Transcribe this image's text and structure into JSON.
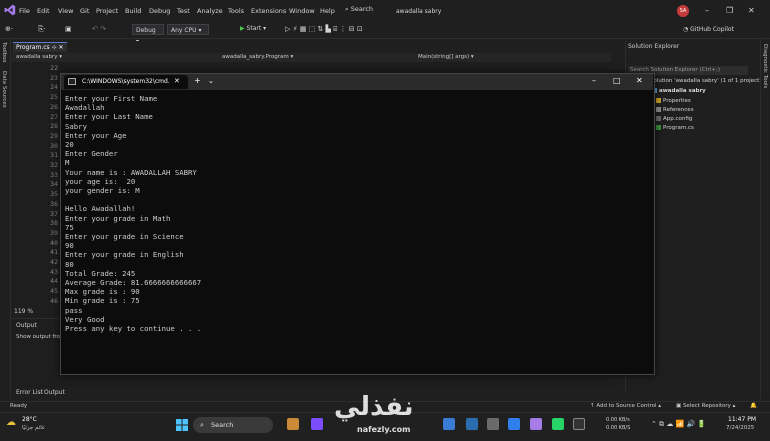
{
  "titlebar": {
    "menu": [
      "File",
      "Edit",
      "View",
      "Git",
      "Project",
      "Build",
      "Debug",
      "Test",
      "Analyze",
      "Tools",
      "Extensions",
      "Window",
      "Help"
    ],
    "search_label": "Search",
    "solution_name": "awadalla sabry",
    "avatar_initials": "SA",
    "minimize": "–",
    "restore": "❐",
    "close": "✕"
  },
  "toolbar": {
    "config": "Debug",
    "platform": "Any CPU",
    "start_label": "Start",
    "copilot_label": "GitHub Copilot"
  },
  "left_rail": {
    "toolbox": "Toolbox",
    "data_sources": "Data Sources"
  },
  "editor": {
    "file_tab": "Program.cs",
    "nav_project": "awadalla sabry",
    "nav_class": "awadalla_sabry.Program",
    "nav_member": "Main(string[] args)",
    "line_numbers": [
      "22",
      "23",
      "24",
      "25",
      "26",
      "27",
      "28",
      "29",
      "30",
      "31",
      "32",
      "33",
      "34",
      "35",
      "36",
      "37",
      "38",
      "39",
      "40",
      "41",
      "42",
      "43",
      "44",
      "45",
      "46"
    ],
    "zoom": "119 %"
  },
  "output": {
    "title": "Output",
    "show_output_from": "Show output fro",
    "tab_error_list": "Error List",
    "tab_output": "Output"
  },
  "solution_explorer": {
    "title": "Solution Explorer",
    "search_placeholder": "Search Solution Explorer (Ctrl+;)",
    "items": [
      {
        "label": "Solution 'awadalla sabry' (1 of 1 project)"
      },
      {
        "label": "awadalla sabry"
      },
      {
        "label": "Properties"
      },
      {
        "label": "References"
      },
      {
        "label": "App.config"
      },
      {
        "label": "Program.cs"
      }
    ]
  },
  "right_rail": {
    "diagnostic": "Diagnostic Tools"
  },
  "statusbar": {
    "ready": "Ready",
    "add_to_source": "Add to Source Control",
    "select_repo": "Select Repository"
  },
  "console": {
    "tab_title": "C:\\WINDOWS\\system32\\cmd.",
    "close_tab": "✕",
    "new_tab": "+",
    "dropdown": "⌄",
    "minimize": "–",
    "maximize": "□",
    "close": "✕",
    "lines": [
      "Enter your First Name",
      "Awadallah",
      "Enter your Last Name",
      "Sabry",
      "Enter your Age",
      "20",
      "Enter Gender",
      "M",
      "Your name is : AWADALLAH SABRY",
      "your age is:  20",
      "your gender is: M",
      "",
      "Hello Awadallah!",
      "Enter your grade in Math",
      "75",
      "Enter your grade in Science",
      "90",
      "Enter your grade in English",
      "80",
      "Total Grade: 245",
      "Average Grade: 81.6666666666667",
      "Max grade is : 90",
      "Min grade is : 75",
      "pass",
      "Very Good",
      "Press any key to continue . . ."
    ]
  },
  "taskbar": {
    "weather_temp": "28°C",
    "weather_desc": "غائم جزئيًا",
    "search_label": "Search",
    "net_up": "0.00 KB/s",
    "net_down": "0.00 KB/S",
    "time": "11:47 PM",
    "date": "7/24/2025"
  },
  "watermark": {
    "brand": "نفذلي",
    "url": "nafezly.com"
  },
  "colors": {
    "vs_purple": "#a37ce8",
    "avatar": "#c43b3b",
    "accent": "#5a7fc7"
  }
}
